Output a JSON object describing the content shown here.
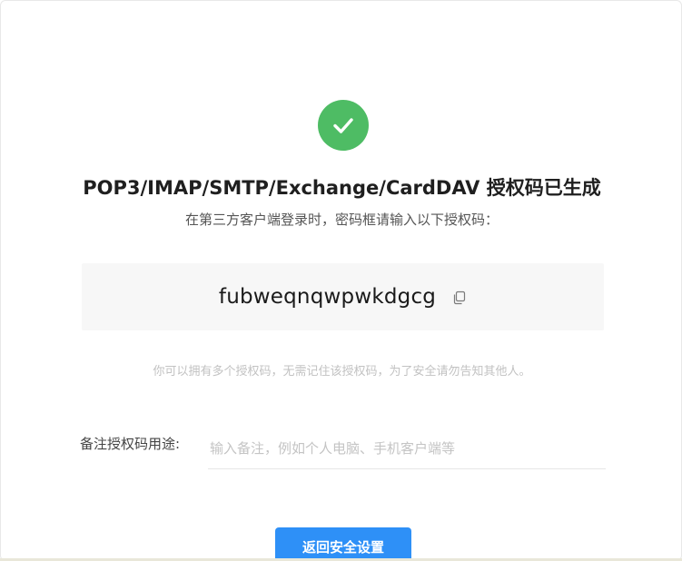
{
  "dialog": {
    "title": "POP3/IMAP/SMTP/Exchange/CardDAV 授权码已生成",
    "subtitle": "在第三方客户端登录时，密码框请输入以下授权码：",
    "auth_code": "fubweqnqwpwkdgcg",
    "hint": "你可以拥有多个授权码，无需记住该授权码，为了安全请勿告知其他人。",
    "remark": {
      "label": "备注授权码用途:",
      "placeholder": "输入备注，例如个人电脑、手机客户端等",
      "value": ""
    },
    "back_button_label": "返回安全设置"
  },
  "colors": {
    "success": "#4ebc64",
    "primary": "#2e90f7",
    "code_bg": "#f7f7f7",
    "hint_text": "#c2c2c2"
  },
  "icons": {
    "status": "check-circle-icon",
    "copy": "copy-icon"
  }
}
